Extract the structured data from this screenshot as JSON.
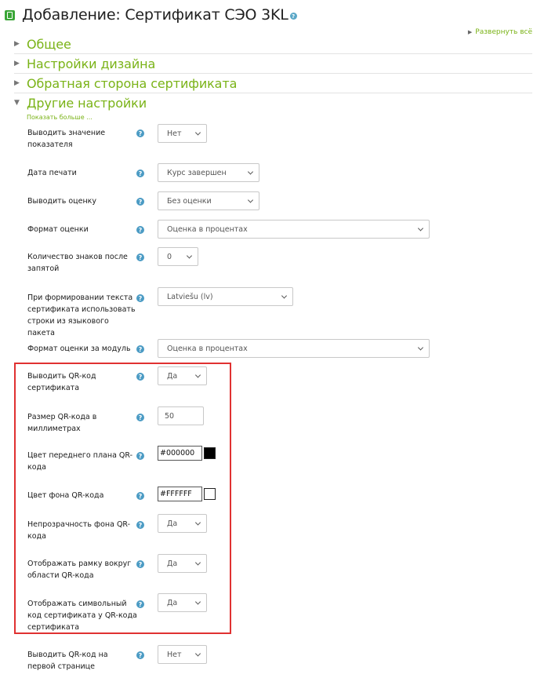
{
  "header": {
    "title": "Добавление: Сертификат СЭО 3KL",
    "help_symbol": "?",
    "expand_all": "Развернуть всё"
  },
  "sections": {
    "general": "Общее",
    "design": "Настройки дизайна",
    "back": "Обратная сторона сертификата",
    "other": "Другие настройки"
  },
  "show_more": "Показать больше ...",
  "fields": {
    "show_indicator": {
      "label": "Выводить значение показателя",
      "value": "Нет"
    },
    "print_date": {
      "label": "Дата печати",
      "value": "Курс завершен"
    },
    "show_grade": {
      "label": "Выводить оценку",
      "value": "Без оценки"
    },
    "grade_format": {
      "label": "Формат оценки",
      "value": "Оценка в процентах"
    },
    "decimals": {
      "label": "Количество знаков после запятой",
      "value": "0"
    },
    "language": {
      "label": "При формировании текста сертификата использовать строки из языкового пакета",
      "value": "Latviešu (lv)"
    },
    "module_grade_format": {
      "label": "Формат оценки за модуль",
      "value": "Оценка в процентах"
    },
    "show_qr": {
      "label": "Выводить QR-код сертификата",
      "value": "Да"
    },
    "qr_size": {
      "label": "Размер QR-кода в миллиметрах",
      "value": "50"
    },
    "qr_fg": {
      "label": "Цвет переднего плана QR-кода",
      "value": "#000000",
      "swatch": "#000000"
    },
    "qr_bg": {
      "label": "Цвет фона QR-кода",
      "value": "#FFFFFF",
      "swatch": "#FFFFFF"
    },
    "qr_opaque": {
      "label": "Непрозрачность фона QR-кода",
      "value": "Да"
    },
    "qr_frame": {
      "label": "Отображать рамку вокруг области QR-кода",
      "value": "Да"
    },
    "qr_symbolic": {
      "label": "Отображать символьный код сертификата у QR-кода сертификата",
      "value": "Да"
    },
    "qr_first_page": {
      "label": "Выводить QR-код на первой странице",
      "value": "Нет"
    }
  },
  "colors": {
    "accent": "#7ab317",
    "help_icon": "#4b9bc4",
    "highlight": "#e03131"
  }
}
